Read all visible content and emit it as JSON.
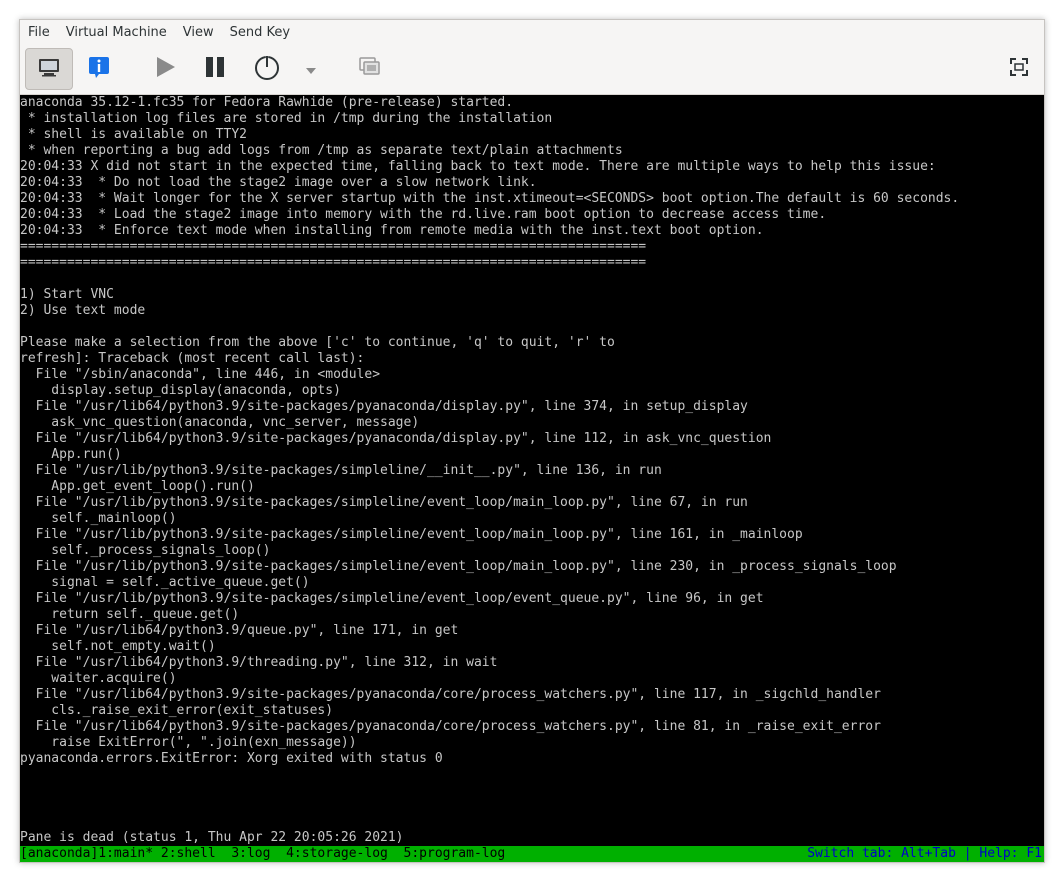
{
  "menubar": {
    "items": [
      "File",
      "Virtual Machine",
      "View",
      "Send Key"
    ]
  },
  "toolbar": {
    "icons": [
      "monitor-icon",
      "info-icon",
      "play-icon",
      "pause-icon",
      "power-icon",
      "chevron-down-icon",
      "snapshots-icon",
      "fullscreen-icon"
    ]
  },
  "terminal": {
    "lines": [
      "anaconda 35.12-1.fc35 for Fedora Rawhide (pre-release) started.",
      " * installation log files are stored in /tmp during the installation",
      " * shell is available on TTY2",
      " * when reporting a bug add logs from /tmp as separate text/plain attachments",
      "20:04:33 X did not start in the expected time, falling back to text mode. There are multiple ways to help this issue:",
      "20:04:33  * Do not load the stage2 image over a slow network link.",
      "20:04:33  * Wait longer for the X server startup with the inst.xtimeout=<SECONDS> boot option.The default is 60 seconds.",
      "20:04:33  * Load the stage2 image into memory with the rd.live.ram boot option to decrease access time.",
      "20:04:33  * Enforce text mode when installing from remote media with the inst.text boot option.",
      "================================================================================",
      "================================================================================",
      "",
      "1) Start VNC",
      "2) Use text mode",
      "",
      "Please make a selection from the above ['c' to continue, 'q' to quit, 'r' to",
      "refresh]: Traceback (most recent call last):",
      "  File \"/sbin/anaconda\", line 446, in <module>",
      "    display.setup_display(anaconda, opts)",
      "  File \"/usr/lib64/python3.9/site-packages/pyanaconda/display.py\", line 374, in setup_display",
      "    ask_vnc_question(anaconda, vnc_server, message)",
      "  File \"/usr/lib64/python3.9/site-packages/pyanaconda/display.py\", line 112, in ask_vnc_question",
      "    App.run()",
      "  File \"/usr/lib/python3.9/site-packages/simpleline/__init__.py\", line 136, in run",
      "    App.get_event_loop().run()",
      "  File \"/usr/lib/python3.9/site-packages/simpleline/event_loop/main_loop.py\", line 67, in run",
      "    self._mainloop()",
      "  File \"/usr/lib/python3.9/site-packages/simpleline/event_loop/main_loop.py\", line 161, in _mainloop",
      "    self._process_signals_loop()",
      "  File \"/usr/lib/python3.9/site-packages/simpleline/event_loop/main_loop.py\", line 230, in _process_signals_loop",
      "    signal = self._active_queue.get()",
      "  File \"/usr/lib/python3.9/site-packages/simpleline/event_loop/event_queue.py\", line 96, in get",
      "    return self._queue.get()",
      "  File \"/usr/lib64/python3.9/queue.py\", line 171, in get",
      "    self.not_empty.wait()",
      "  File \"/usr/lib64/python3.9/threading.py\", line 312, in wait",
      "    waiter.acquire()",
      "  File \"/usr/lib64/python3.9/site-packages/pyanaconda/core/process_watchers.py\", line 117, in _sigchld_handler",
      "    cls._raise_exit_error(exit_statuses)",
      "  File \"/usr/lib64/python3.9/site-packages/pyanaconda/core/process_watchers.py\", line 81, in _raise_exit_error",
      "    raise ExitError(\", \".join(exn_message))",
      "pyanaconda.errors.ExitError: Xorg exited with status 0"
    ],
    "pane_status": "Pane is dead (status 1, Thu Apr 22 20:05:26 2021)",
    "tmux_left": "[anaconda]1:main* 2:shell  3:log  4:storage-log  5:program-log",
    "tmux_right": "Switch tab: Alt+Tab | Help: F1"
  },
  "colors": {
    "terminal_bg": "#000000",
    "terminal_fg": "#c7c7c7",
    "tmux_bar": "#00b000",
    "tmux_right_text": "#0000c8",
    "info_icon": "#1a73e8"
  }
}
